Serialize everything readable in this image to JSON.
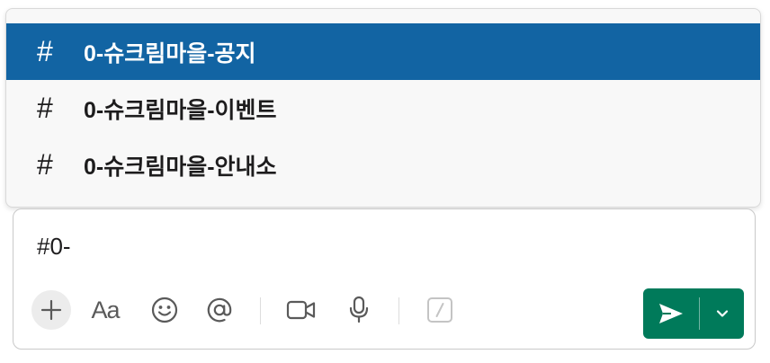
{
  "channel_suggestions": {
    "hash_glyph": "#",
    "items": [
      {
        "label": "0-슈크림마을-공지",
        "selected": true
      },
      {
        "label": "0-슈크림마을-이벤트",
        "selected": false
      },
      {
        "label": "0-슈크림마을-안내소",
        "selected": false
      }
    ]
  },
  "composer": {
    "input_value": "#0-"
  },
  "toolbar": {
    "format_label": "Aa",
    "icons": [
      "plus-icon",
      "format-text-icon",
      "emoji-icon",
      "mention-icon",
      "video-icon",
      "microphone-icon",
      "slash-command-icon",
      "send-icon",
      "chevron-down-icon"
    ]
  },
  "colors": {
    "selected_bg": "#1264a3",
    "send_bg": "#007a5a",
    "text": "#1d1c1d",
    "icon": "#5a5a5a"
  }
}
